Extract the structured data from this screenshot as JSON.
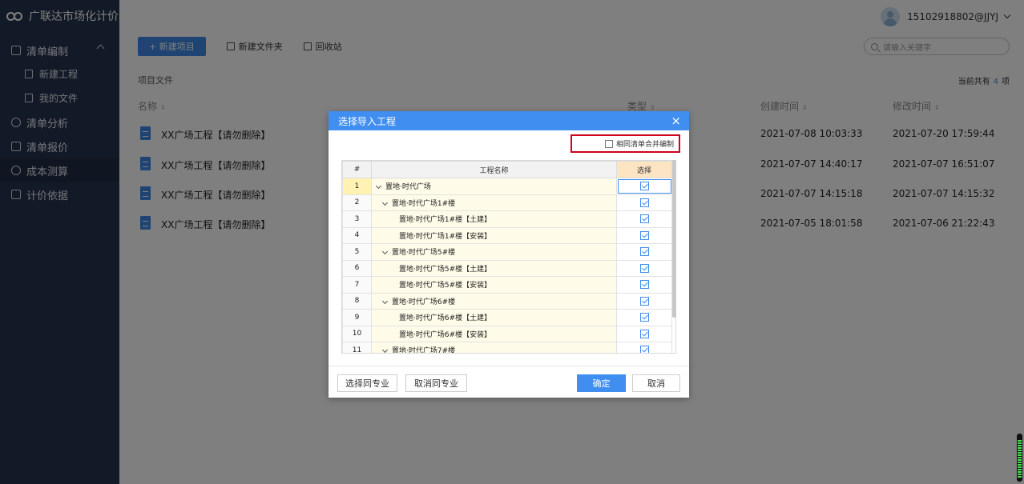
{
  "app": {
    "title": "广联达市场化计价"
  },
  "sidebar": {
    "items": [
      {
        "label": "清单编制"
      },
      {
        "label": "新建工程"
      },
      {
        "label": "我的文件"
      },
      {
        "label": "清单分析"
      },
      {
        "label": "清单报价"
      },
      {
        "label": "成本测算"
      },
      {
        "label": "计价依据"
      }
    ]
  },
  "topbar": {
    "user": "15102918802@JJYJ"
  },
  "toolbar": {
    "new_project": "+ 新建项目",
    "new_folder": "新建文件夹",
    "recycle": "回收站"
  },
  "search": {
    "placeholder": "请输入关键字"
  },
  "files": {
    "section": "项目文件",
    "count_prefix": "当前共有",
    "count": "4",
    "count_suffix": "项",
    "headers": {
      "name": "名称",
      "type": "类型",
      "created": "创建时间",
      "modified": "修改时间"
    },
    "rows": [
      {
        "name": "XX广场工程【请勿删除】",
        "created": "2021-07-08 10:03:33",
        "modified": "2021-07-20 17:59:44"
      },
      {
        "name": "XX广场工程【请勿删除】",
        "created": "2021-07-07 14:40:17",
        "modified": "2021-07-07 16:51:07"
      },
      {
        "name": "XX广场工程【请勿删除】",
        "created": "2021-07-07 14:15:18",
        "modified": "2021-07-07 14:15:32"
      },
      {
        "name": "XX广场工程【请勿删除】",
        "created": "2021-07-05 18:01:58",
        "modified": "2021-07-06 21:22:43"
      }
    ]
  },
  "dialog": {
    "title": "选择导入工程",
    "close": "×",
    "merge_label": "相同清单合并编制",
    "col_num": "#",
    "col_name": "工程名称",
    "col_select": "选择",
    "rows": [
      {
        "num": "1",
        "name": "置地·时代广场",
        "level": 0,
        "toggle": true
      },
      {
        "num": "2",
        "name": "置地·时代广场1#楼",
        "level": 1,
        "toggle": true
      },
      {
        "num": "3",
        "name": "置地·时代广场1#楼【土建】",
        "level": 2,
        "toggle": false
      },
      {
        "num": "4",
        "name": "置地·时代广场1#楼【安装】",
        "level": 2,
        "toggle": false
      },
      {
        "num": "5",
        "name": "置地·时代广场5#楼",
        "level": 1,
        "toggle": true
      },
      {
        "num": "6",
        "name": "置地·时代广场5#楼【土建】",
        "level": 2,
        "toggle": false
      },
      {
        "num": "7",
        "name": "置地·时代广场5#楼【安装】",
        "level": 2,
        "toggle": false
      },
      {
        "num": "8",
        "name": "置地·时代广场6#楼",
        "level": 1,
        "toggle": true
      },
      {
        "num": "9",
        "name": "置地·时代广场6#楼【土建】",
        "level": 2,
        "toggle": false
      },
      {
        "num": "10",
        "name": "置地·时代广场6#楼【安装】",
        "level": 2,
        "toggle": false
      },
      {
        "num": "11",
        "name": "置地·时代广场7#楼",
        "level": 1,
        "toggle": true
      }
    ],
    "buttons": {
      "select_same": "选择同专业",
      "cancel_same": "取消同专业",
      "ok": "确定",
      "cancel": "取消"
    }
  }
}
